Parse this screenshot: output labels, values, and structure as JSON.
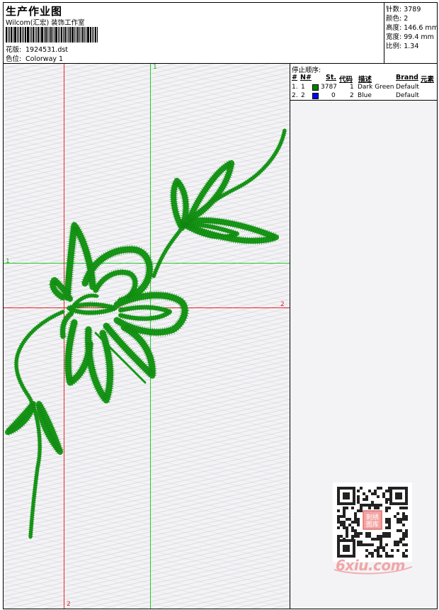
{
  "header": {
    "title": "生产作业图",
    "company": "Wilcom(汇宏) 装饰工作室",
    "design_label": "花版:",
    "design_value": "1924531.dst",
    "colorway_label": "色位:",
    "colorway_value": "Colorway 1"
  },
  "stats": {
    "stitches": "针数: 3789",
    "colors": "颜色: 2",
    "height": "高度: 146.6 mm",
    "width": "宽度: 99.4 mm",
    "ratio": "比例: 1.34"
  },
  "guides": {
    "green_v_label": "1",
    "green_h_label": "1",
    "red_v_label": "2",
    "red_h_label": "2"
  },
  "stop_sequence": {
    "title": "停止顺序:",
    "columns": [
      "#",
      "N#",
      "St.",
      "代码",
      "描述",
      "Brand",
      "元素"
    ],
    "rows": [
      {
        "idx": "1.",
        "n": "1",
        "stitches": "3787",
        "code": "1",
        "desc": "Dark Green",
        "brand": "Default",
        "color": "#008000"
      },
      {
        "idx": "2.",
        "n": "2",
        "stitches": "0",
        "code": "2",
        "desc": "Blue",
        "brand": "Default",
        "color": "#0000ff"
      }
    ]
  },
  "colors": {
    "thread": "#189a18",
    "guide_green": "#22cc22",
    "guide_red": "#ee2222"
  },
  "watermark": {
    "text": "6xiu.com",
    "stamp": "刺绣图库"
  }
}
